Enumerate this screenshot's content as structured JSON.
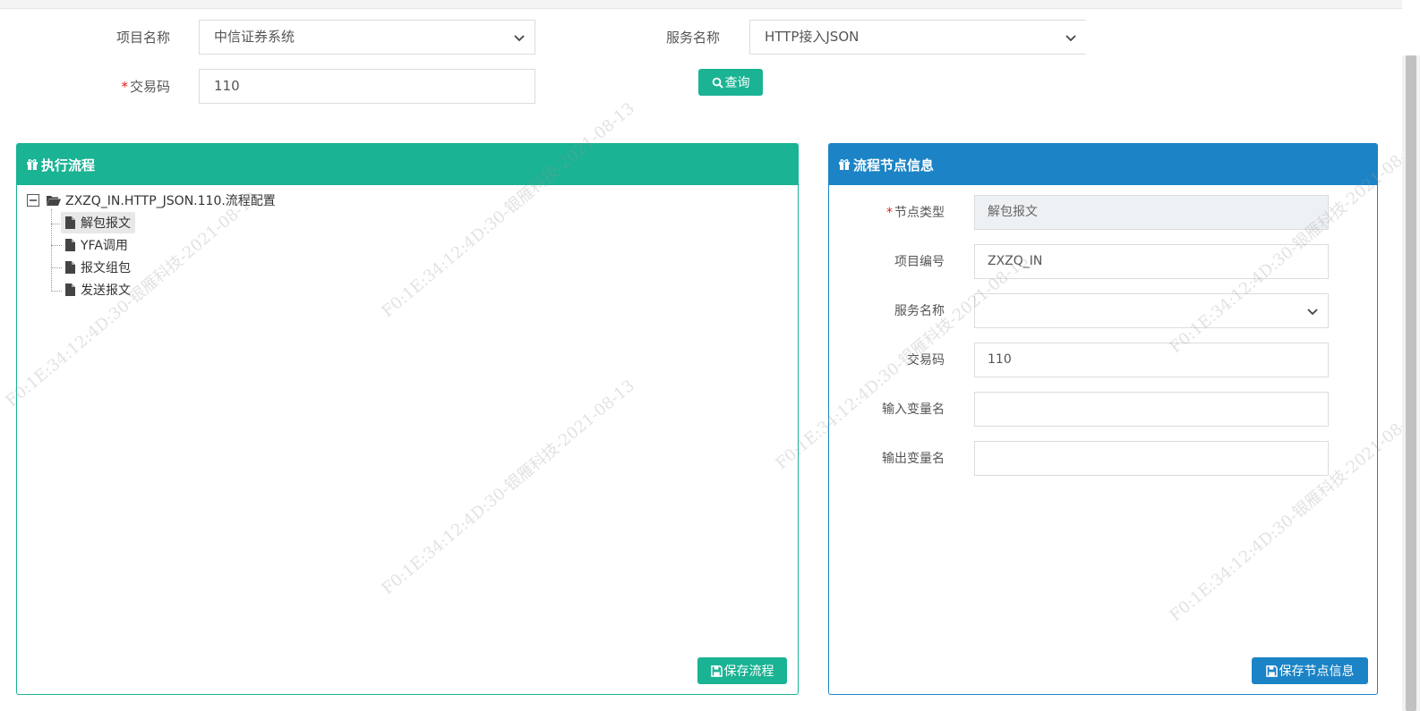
{
  "search": {
    "project_label": "项目名称",
    "project_value": "中信证券系统",
    "service_label": "服务名称",
    "service_value": "HTTP接入JSON",
    "txcode_label": "交易码",
    "txcode_value": "110",
    "query_button": "查询"
  },
  "left_panel": {
    "title": "执行流程",
    "tree_root": "ZXZQ_IN.HTTP_JSON.110.流程配置",
    "tree_items": [
      "解包报文",
      "YFA调用",
      "报文组包",
      "发送报文"
    ],
    "save_button": "保存流程"
  },
  "right_panel": {
    "title": "流程节点信息",
    "node_type_label": "节点类型",
    "node_type_value": "解包报文",
    "project_no_label": "项目编号",
    "project_no_value": "ZXZQ_IN",
    "service_label": "服务名称",
    "service_value": "",
    "txcode_label": "交易码",
    "txcode_value": "110",
    "input_var_label": "输入变量名",
    "input_var_value": "",
    "output_var_label": "输出变量名",
    "output_var_value": "",
    "save_button": "保存节点信息"
  },
  "watermark_text": "F0:1E:34:12:4D:30-银雁科技-2021-08-13",
  "colors": {
    "green": "#1ab394",
    "blue": "#1c84c6",
    "required": "#e0201b"
  }
}
